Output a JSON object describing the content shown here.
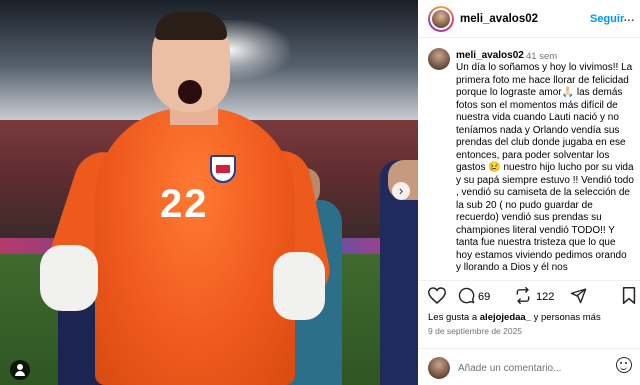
{
  "post": {
    "username": "meli_avalos02",
    "follow_label": "Seguir",
    "more_label": "···"
  },
  "caption": {
    "username": "meli_avalos02",
    "time": "41 sem",
    "text": "Un día lo soñamos y hoy lo vivimos!! La primera foto me hace llorar de felicidad porque lo lograste amor🙏🏻 las demás fotos son el momentos más difícil de nuestra vida cuando Lauti nació y no teníamos nada y Orlando vendía sus prendas del club donde jugaba en ese entonces, para poder solventar los gastos 😢 nuestro hijo lucho por su vida y su papá siempre estuvo !! Vendió todo , vendió su camiseta de la selección de la sub 20 ( no pudo guardar de recuerdo) vendió sus prendas su championes literal vendió TODO!! Y tanta fue nuestra tristeza que lo que hoy estamos viviendo pedimos orando y llorando a Dios y él nos"
  },
  "photo": {
    "jersey_number": "22",
    "next_icon": "›"
  },
  "actions": {
    "comments_count": "69",
    "shares_count": "122"
  },
  "likes": {
    "prefix": "Les gusta a ",
    "user": "alejojedaa_",
    "suffix": " y personas más"
  },
  "date": "9 de septiembre de 2025",
  "comment": {
    "placeholder": "Añade un comentario..."
  },
  "icons": {
    "like": "heart-icon",
    "comment": "comment-icon",
    "share": "share-icon",
    "save": "bookmark-icon",
    "emoji": "emoji-icon",
    "next": "chevron-right-icon",
    "tag": "user-tag-icon",
    "more": "more-icon"
  },
  "colors": {
    "link": "#0095f6",
    "secondary_text": "#737373",
    "keeper_jersey": "#f05a1e"
  }
}
